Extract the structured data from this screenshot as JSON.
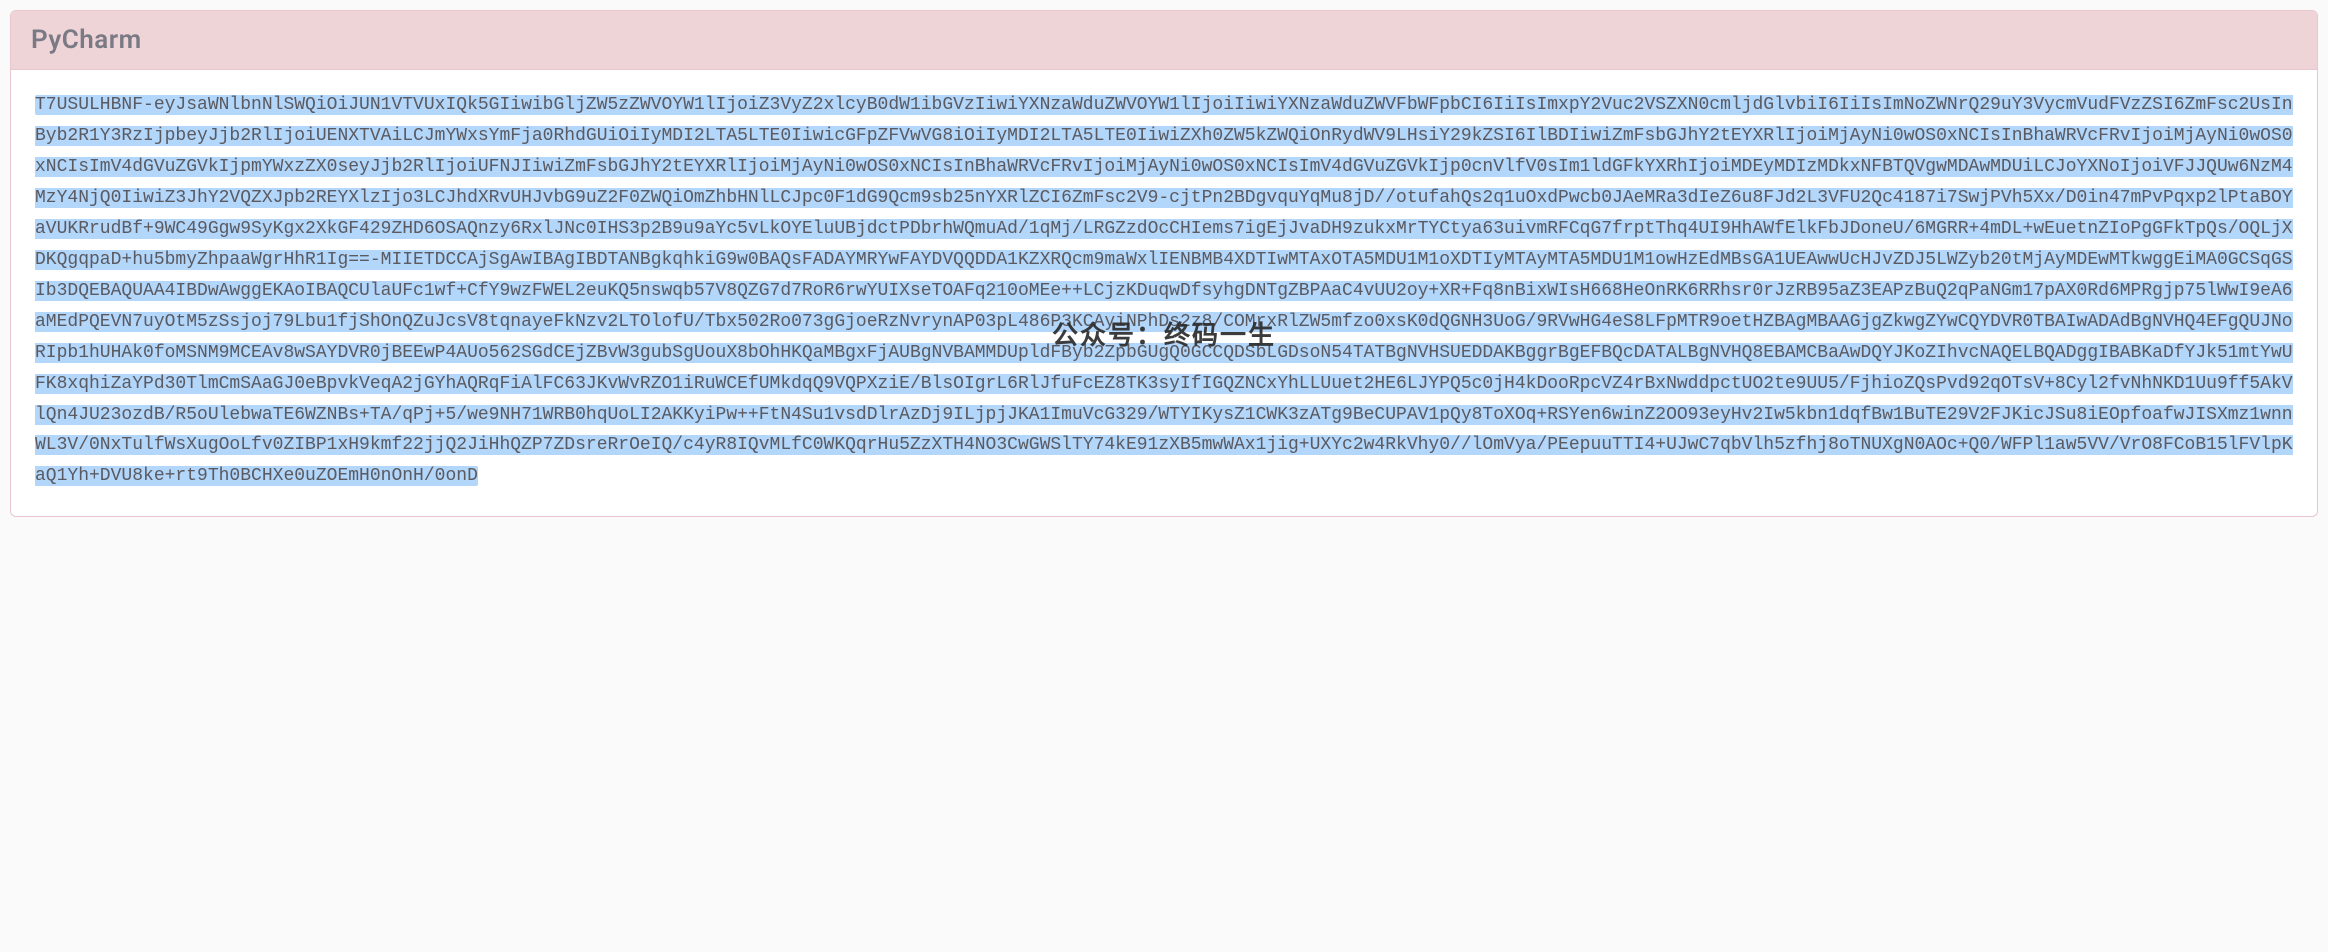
{
  "card": {
    "title": "PyCharm",
    "code": "T7USULHBNF-eyJsaWNlbnNlSWQiOiJUN1VTVUxIQk5GIiwibGljZW5zZWVOYW1lIjoiZ3VyZ2xlcyB0dW1ibGVzIiwiYXNzaWduZWVOYW1lIjoiIiwiYXNzaWduZWVFbWFpbCI6IiIsImxpY2Vuc2VSZXN0cmljdGlvbiI6IiIsImNoZWNrQ29uY3VycmVudFVzZSI6ZmFsc2UsInByb2R1Y3RzIjpbeyJjb2RlIjoiUENXTVAiLCJmYWxsYmFja0RhdGUiOiIyMDI2LTA5LTE0IiwicGFpZFVwVG8iOiIyMDI2LTA5LTE0IiwiZXh0ZW5kZWQiOnRydWV9LHsiY29kZSI6IlBDIiwiZmFsbGJhY2tEYXRlIjoiMjAyNi0wOS0xNCIsInBhaWRVcFRvIjoiMjAyNi0wOS0xNCIsImV4dGVuZGVkIjpmYWxzZX0seyJjb2RlIjoiUFNJIiwiZmFsbGJhY2tEYXRlIjoiMjAyNi0wOS0xNCIsInBhaWRVcFRvIjoiMjAyNi0wOS0xNCIsImV4dGVuZGVkIjp0cnVlfV0sIm1ldGFkYXRhIjoiMDEyMDIzMDkxNFBTQVgwMDAwMDUiLCJoYXNoIjoiVFJJQUw6NzM4MzY4NjQ0IiwiZ3JhY2VQZXJpb2REYXlzIjo3LCJhdXRvUHJvbG9uZ2F0ZWQiOmZhbHNlLCJpc0F1dG9Qcm9sb25nYXRlZCI6ZmFsc2V9-cjtPn2BDgvquYqMu8jD//otufahQs2q1uOxdPwcb0JAeMRa3dIeZ6u8FJd2L3VFU2Qc4187i7SwjPVh5Xx/D0in47mPvPqxp2lPtaBOYaVUKRrudBf+9WC49Ggw9SyKgx2XkGF429ZHD6OSAQnzy6RxlJNc0IHS3p2B9u9aYc5vLkOYEluUBjdctPDbrhWQmuAd/1qMj/LRGZzdOcCHIems7igEjJvaDH9zukxMrTYCtya63uivmRFCqG7frptThq4UI9HhAWfElkFbJDoneU/6MGRR+4mDL+wEuetnZIoPgGFkTpQs/OQLjXDKQgqpaD+hu5bmyZhpaaWgrHhR1Ig==-MIIETDCCAjSgAwIBAgIBDTANBgkqhkiG9w0BAQsFADAYMRYwFAYDVQQDDA1KZXRQcm9maWxlIENBMB4XDTIwMTAxOTA5MDU1M1oXDTIyMTAyMTA5MDU1M1owHzEdMBsGA1UEAwwUcHJvZDJ5LWZyb20tMjAyMDEwMTkwggEiMA0GCSqGSIb3DQEBAQUAA4IBDwAwggEKAoIBAQCUlaUFc1wf+CfY9wzFWEL2euKQ5nswqb57V8QZG7d7RoR6rwYUIXseTOAFq210oMEe++LCjzKDuqwDfsyhgDNTgZBPAaC4vUU2oy+XR+Fq8nBixWIsH668HeOnRK6RRhsr0rJzRB95aZ3EAPzBuQ2qPaNGm17pAX0Rd6MPRgjp75lWwI9eA6aMEdPQEVN7uyOtM5zSsjoj79Lbu1fjShOnQZuJcsV8tqnayeFkNzv2LTOlofU/Tbx502Ro073gGjoeRzNvrynAP03pL486P3KCAyiNPhDs2z8/COMrxRlZW5mfzo0xsK0dQGNH3UoG/9RVwHG4eS8LFpMTR9oetHZBAgMBAAGjgZkwgZYwCQYDVR0TBAIwADAdBgNVHQ4EFgQUJNoRIpb1hUHAk0foMSNM9MCEAv8wSAYDVR0jBEEwP4AUo562SGdCEjZBvW3gubSgUouX8bOhHKQaMBgxFjAUBgNVBAMMDUpldFByb2ZpbGUgQ0GCCQDSbLGDsoN54TATBgNVHSUEDDAKBggrBgEFBQcDATALBgNVHQ8EBAMCBaAwDQYJKoZIhvcNAQELBQADggIBABKaDfYJk51mtYwUFK8xqhiZaYPd30TlmCmSAaGJ0eBpvkVeqA2jGYhAQRqFiAlFC63JKvWvRZO1iRuWCEfUMkdqQ9VQPXziE/BlsOIgrL6RlJfuFcEZ8TK3syIfIGQZNCxYhLLUuet2HE6LJYPQ5c0jH4kDooRpcVZ4rBxNwddpctUO2te9UU5/FjhioZQsPvd92qOTsV+8Cyl2fvNhNKD1Uu9ff5AkVlQn4JU23ozdB/R5oUlebwaTE6WZNBs+TA/qPj+5/we9NH71WRB0hqUoLI2AKKyiPw++FtN4Su1vsdDlrAzDj9ILjpjJKA1ImuVcG329/WTYIKysZ1CWK3zATg9BeCUPAV1pQy8ToXOq+RSYen6winZ2OO93eyHv2Iw5kbn1dqfBw1BuTE29V2FJKicJSu8iEOpfoafwJISXmz1wnnWL3V/0NxTulfWsXugOoLfv0ZIBP1xH9kmf22jjQ2JiHhQZP7ZDsreRrOeIQ/c4yR8IQvMLfC0WKQqrHu5ZzXTH4NO3CwGWSlTY74kE91zXB5mwWAx1jig+UXYc2w4RkVhy0//lOmVya/PEepuuTTI4+UJwC7qbVlh5zfhj8oTNUXgN0AOc+Q0/WFPl1aw5VV/VrO8FCoB15lFVlpKaQ1Yh+DVU8ke+rt9Th0BCHXe0uZOEmH0nOnH/0onD"
  },
  "watermark": {
    "text": "公众号：终码一生"
  }
}
